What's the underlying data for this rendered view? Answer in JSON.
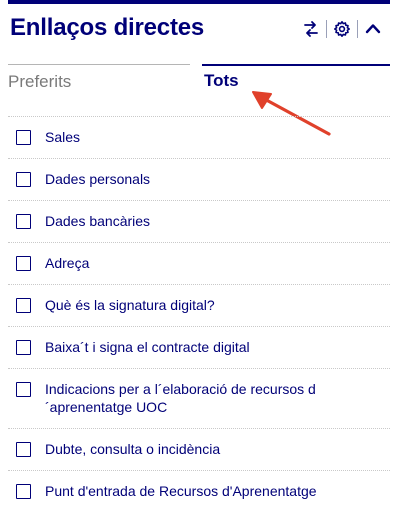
{
  "header": {
    "title": "Enllaços directes",
    "icons": [
      "swap-icon",
      "gear-icon",
      "chevron-up-icon"
    ]
  },
  "tabs": {
    "favorites": "Preferits",
    "all": "Tots",
    "active": "all"
  },
  "links": [
    {
      "label": "Sales",
      "checked": false
    },
    {
      "label": "Dades personals",
      "checked": false
    },
    {
      "label": "Dades bancàries",
      "checked": false
    },
    {
      "label": "Adreça",
      "checked": false
    },
    {
      "label": "Què és la signatura digital?",
      "checked": false
    },
    {
      "label": "Baixa´t i signa el contracte digital",
      "checked": false
    },
    {
      "label": "Indicacions per a l´elaboració de recursos d ´aprenentatge UOC",
      "checked": false
    },
    {
      "label": "Dubte, consulta o incidència",
      "checked": false
    },
    {
      "label": "Punt d'entrada de Recursos d'Aprenentatge",
      "checked": false
    }
  ],
  "colors": {
    "brand": "#000078",
    "annotation_arrow": "#e0412b",
    "inactive_tab": "#7a7a7a"
  }
}
